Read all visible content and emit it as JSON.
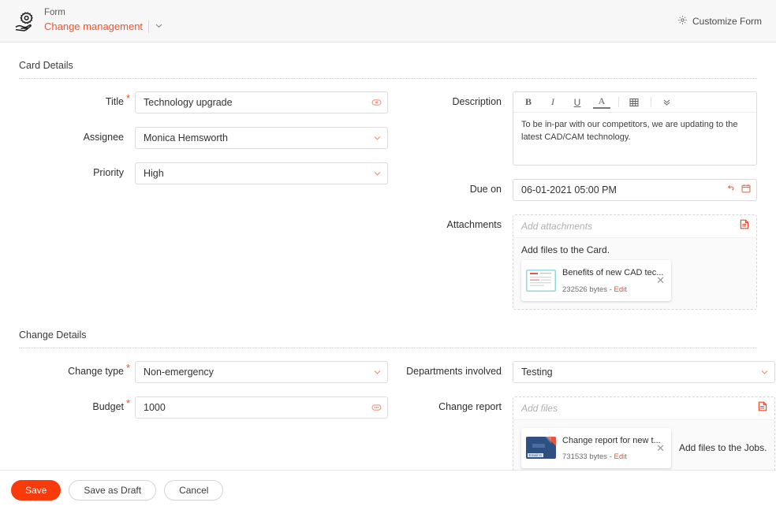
{
  "header": {
    "logo_icon": "hand-gear-icon",
    "kicker": "Form",
    "title": "Change management",
    "dropdown_icon": "chevron-down-icon",
    "customize": {
      "icon": "gear-icon",
      "label": "Customize Form"
    }
  },
  "sections": [
    {
      "id": "card_details",
      "title": "Card Details"
    },
    {
      "id": "change_details",
      "title": "Change Details"
    }
  ],
  "card_details": {
    "title": {
      "label": "Title",
      "required": true,
      "value": "Technology upgrade",
      "icon": "text-field-icon"
    },
    "assignee": {
      "label": "Assignee",
      "required": false,
      "value": "Monica Hemsworth",
      "icon": "chevron-down-icon"
    },
    "priority": {
      "label": "Priority",
      "required": false,
      "value": "High",
      "icon": "chevron-down-icon"
    },
    "description": {
      "label": "Description",
      "toolbar": [
        {
          "name": "bold-icon",
          "glyph": "B"
        },
        {
          "name": "italic-icon",
          "glyph": "I"
        },
        {
          "name": "underline-icon",
          "glyph": "U"
        },
        {
          "name": "font-color-icon",
          "glyph": "A"
        },
        {
          "name": "table-icon",
          "glyph": "⌸"
        },
        {
          "name": "more-options-icon",
          "glyph": "»"
        }
      ],
      "value": "To be in-par with our competitors, we are updating to the latest CAD/CAM technology."
    },
    "due_on": {
      "label": "Due on",
      "value": "06-01-2021 05:00 PM",
      "reset_icon": "undo-arrow-icon",
      "calendar_icon": "calendar-icon"
    },
    "attachments": {
      "label": "Attachments",
      "placeholder": "Add attachments",
      "upload_icon": "attach-file-icon",
      "hint": "Add files to the Card.",
      "files": [
        {
          "name": "Benefits of new CAD tec...",
          "size": "232526 bytes",
          "separator": "-",
          "edit_label": "Edit",
          "remove_icon": "close-icon",
          "thumb": "document-screenshot-thumbnail"
        }
      ]
    }
  },
  "change_details": {
    "change_type": {
      "label": "Change type",
      "required": true,
      "value": "Non-emergency",
      "icon": "chevron-down-icon"
    },
    "budget": {
      "label": "Budget",
      "required": true,
      "value": "1000",
      "icon": "text-field-icon"
    },
    "departments": {
      "label": "Departments involved",
      "value": "Testing",
      "icon": "chevron-down-icon"
    },
    "change_report": {
      "label": "Change report",
      "placeholder": "Add files",
      "upload_icon": "attach-file-icon",
      "hint": "Add files to the Jobs.",
      "files": [
        {
          "name": "Change report for new t...",
          "size": "731533 bytes",
          "separator": "-",
          "edit_label": "Edit",
          "remove_icon": "close-icon",
          "thumb": "email-attachment-thumbnail"
        }
      ]
    }
  },
  "footer": {
    "save": "Save",
    "save_draft": "Save as Draft",
    "cancel": "Cancel"
  },
  "colors": {
    "accent": "#f93a0b",
    "link": "#f8522b",
    "required": "#f34f28",
    "header_bg": "#f7f7f7",
    "border": "#dcdcdc"
  }
}
